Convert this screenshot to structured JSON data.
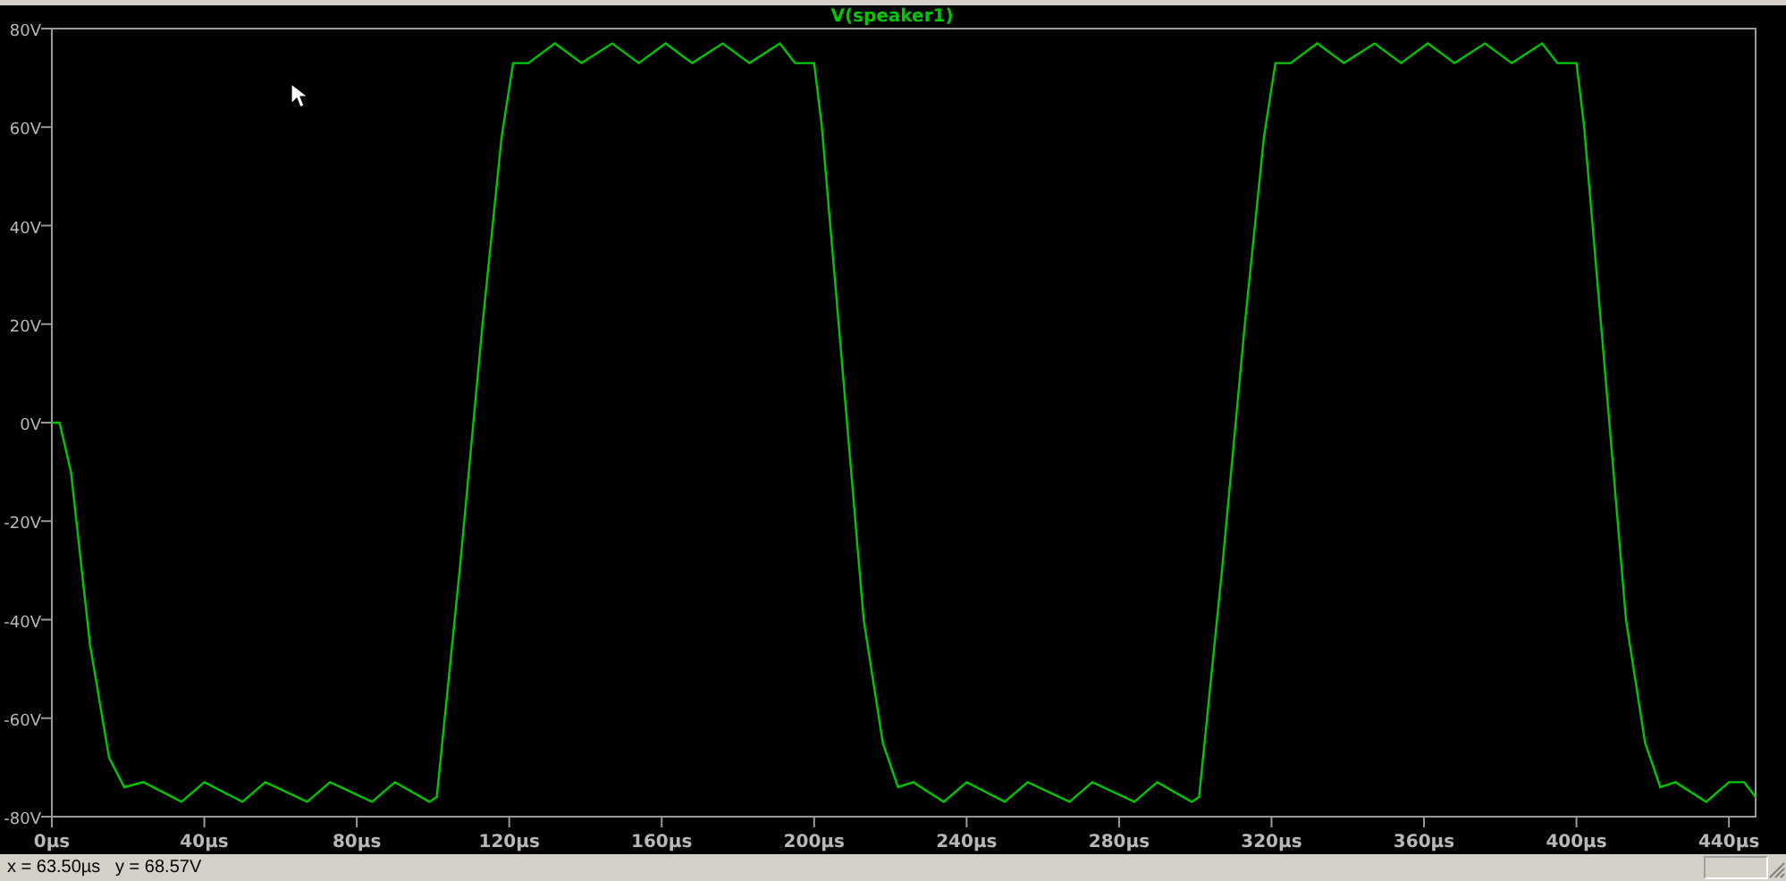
{
  "plot": {
    "chart_data": {
      "type": "line",
      "x": [
        0,
        2,
        5,
        10,
        15,
        19,
        24,
        34,
        40,
        50,
        56,
        67,
        73,
        84,
        90,
        99,
        101,
        107,
        113,
        118,
        121,
        125,
        132,
        139,
        147,
        154,
        161,
        168,
        176,
        183,
        191,
        195,
        200,
        202,
        207,
        213,
        218,
        222,
        226,
        234,
        240,
        250,
        256,
        267,
        273,
        284,
        290,
        299,
        301,
        307,
        313,
        318,
        321,
        325,
        332,
        339,
        347,
        354,
        361,
        368,
        376,
        383,
        391,
        395,
        400,
        402,
        407,
        413,
        418,
        422,
        426,
        434,
        440,
        444,
        447
      ],
      "series": [
        {
          "name": "V(speaker1)",
          "color": "#00c800",
          "values": [
            0,
            0,
            -10,
            -45,
            -68,
            -74,
            -73,
            -77,
            -73,
            -77,
            -73,
            -77,
            -73,
            -77,
            -73,
            -77,
            -76,
            -30,
            20,
            58,
            73,
            73,
            77,
            73,
            77,
            73,
            77,
            73,
            77,
            73,
            77,
            73,
            73,
            60,
            15,
            -40,
            -65,
            -74,
            -73,
            -77,
            -73,
            -77,
            -73,
            -77,
            -73,
            -77,
            -73,
            -77,
            -76,
            -30,
            20,
            58,
            73,
            73,
            77,
            73,
            77,
            73,
            77,
            73,
            77,
            73,
            77,
            73,
            73,
            60,
            15,
            -40,
            -65,
            -74,
            -73,
            -77,
            -73,
            -73,
            -76
          ]
        }
      ],
      "xlim": [
        0,
        447
      ],
      "ylim": [
        -80,
        80
      ],
      "xticks": [
        {
          "value": 0,
          "label": "0µs"
        },
        {
          "value": 40,
          "label": "40µs"
        },
        {
          "value": 80,
          "label": "80µs"
        },
        {
          "value": 120,
          "label": "120µs"
        },
        {
          "value": 160,
          "label": "160µs"
        },
        {
          "value": 200,
          "label": "200µs"
        },
        {
          "value": 240,
          "label": "240µs"
        },
        {
          "value": 280,
          "label": "280µs"
        },
        {
          "value": 320,
          "label": "320µs"
        },
        {
          "value": 360,
          "label": "360µs"
        },
        {
          "value": 400,
          "label": "400µs"
        },
        {
          "value": 440,
          "label": "440µs"
        }
      ],
      "yticks": [
        {
          "value": 80,
          "label": "80V"
        },
        {
          "value": 60,
          "label": "60V"
        },
        {
          "value": 40,
          "label": "40V"
        },
        {
          "value": 20,
          "label": "20V"
        },
        {
          "value": 0,
          "label": "0V"
        },
        {
          "value": -20,
          "label": "-20V"
        },
        {
          "value": -40,
          "label": "-40V"
        },
        {
          "value": -60,
          "label": "-60V"
        },
        {
          "value": -80,
          "label": "-80V"
        }
      ]
    }
  },
  "status_bar": {
    "readout": "x = 63.50µs   y = 68.57V"
  }
}
